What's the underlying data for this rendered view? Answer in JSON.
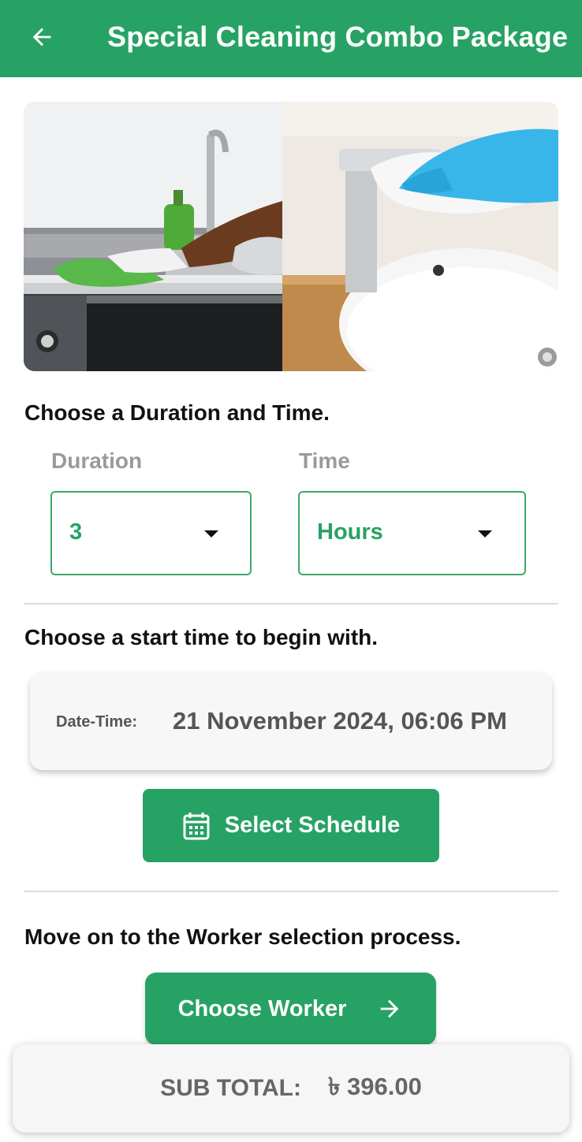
{
  "appbar": {
    "title": "Special Cleaning Combo Package",
    "back_icon": "arrow-left-icon",
    "color": "#27a265"
  },
  "hero": {
    "images": [
      "kitchen-counter-cleaning",
      "bathroom-sink-cleaning"
    ]
  },
  "duration_section": {
    "heading": "Choose a Duration and Time.",
    "duration_label": "Duration",
    "duration_value": "3",
    "time_label": "Time",
    "time_value": "Hours"
  },
  "schedule_section": {
    "heading": "Choose a start time to begin with.",
    "datetime_label": "Date-Time:",
    "datetime_value": "21 November 2024, 06:06 PM",
    "button_label": "Select Schedule",
    "button_icon": "calendar-icon"
  },
  "worker_section": {
    "heading": "Move on to the Worker selection process.",
    "button_label": "Choose Worker",
    "button_icon": "arrow-right-icon"
  },
  "footer": {
    "subtotal_label": "SUB TOTAL:",
    "subtotal_amount": "৳ 396.00"
  }
}
